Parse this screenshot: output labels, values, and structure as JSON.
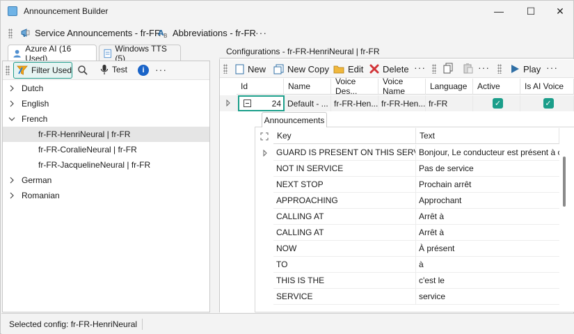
{
  "window": {
    "title": "Announcement Builder",
    "controls": {
      "minimize": "—",
      "maximize": "☐",
      "close": "✕"
    }
  },
  "doc_tabs": [
    {
      "label": "Service Announcements - fr-FR",
      "icon": "megaphone-icon"
    },
    {
      "label": "Abbreviations - fr-FR",
      "icon": "abbreviation-icon"
    }
  ],
  "more_glyph": "···",
  "left": {
    "tabs": [
      {
        "label": "Azure AI (16 Used)",
        "active": true
      },
      {
        "label": "Windows TTS (5)",
        "active": false
      }
    ],
    "toolbar": {
      "filter_label": "Filter Used",
      "test_label": "Test"
    },
    "tree": [
      {
        "label": "Dutch",
        "expanded": false
      },
      {
        "label": "English",
        "expanded": false
      },
      {
        "label": "French",
        "expanded": true
      },
      {
        "label": "fr-FR-HenriNeural | fr-FR",
        "child": true,
        "selected": true
      },
      {
        "label": "fr-FR-CoralieNeural | fr-FR",
        "child": true
      },
      {
        "label": "fr-FR-JacquelineNeural | fr-FR",
        "child": true
      },
      {
        "label": "German",
        "expanded": false
      },
      {
        "label": "Romanian",
        "expanded": false
      }
    ]
  },
  "right": {
    "header": "Configurations - fr-FR-HenriNeural | fr-FR",
    "toolbar": {
      "new_label": "New",
      "new_copy_label": "New Copy",
      "edit_label": "Edit",
      "delete_label": "Delete",
      "play_label": "Play"
    },
    "columns": [
      "Id",
      "Name",
      "Voice Des...",
      "Voice Name",
      "Language",
      "Active",
      "Is AI Voice"
    ],
    "row": {
      "id": "24",
      "name": "Default - ...",
      "voice_desc": "fr-FR-Hen...",
      "voice_name": "fr-FR-Hen...",
      "language": "fr-FR",
      "active": true,
      "is_ai_voice": true
    },
    "detail": {
      "tab_label": "Announcements",
      "columns": [
        "Key",
        "Text"
      ],
      "rows": [
        {
          "key": "GUARD IS PRESENT ON THIS SERVICE",
          "text": "Bonjour, Le conducteur est présent à c..."
        },
        {
          "key": "NOT IN SERVICE",
          "text": "Pas de service"
        },
        {
          "key": "NEXT STOP",
          "text": "Prochain arrêt"
        },
        {
          "key": "APPROACHING",
          "text": "Approchant"
        },
        {
          "key": "CALLING AT",
          "text": "Arrêt à"
        },
        {
          "key": "CALLING AT",
          "text": "Arrêt à"
        },
        {
          "key": "NOW",
          "text": "À présent"
        },
        {
          "key": "TO",
          "text": "à"
        },
        {
          "key": "THIS IS THE",
          "text": "c'est le"
        },
        {
          "key": "SERVICE",
          "text": "service"
        }
      ]
    }
  },
  "status": {
    "text": "Selected config: fr-FR-HenriNeural"
  },
  "colors": {
    "accent": "#1b9e8a",
    "selection": "#e5e5e5",
    "info": "#1a64c8"
  }
}
